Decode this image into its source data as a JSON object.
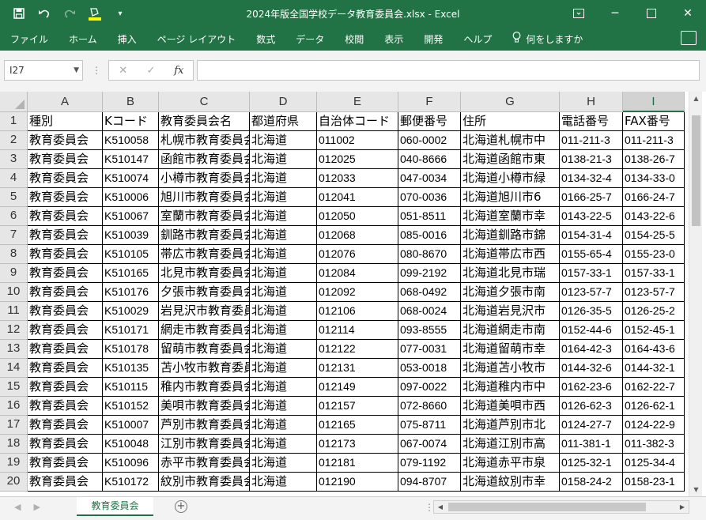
{
  "window": {
    "title": "2024年版全国学校データ教育委員会.xlsx  -  Excel",
    "controls": {
      "minimize": "─",
      "restore": "❐",
      "maximize": "☐",
      "close": "✕"
    }
  },
  "qat": {
    "save_icon": "save-icon",
    "undo_icon": "undo-icon",
    "redo_icon": "redo-icon",
    "fill_icon": "fill-color-icon",
    "customize_icon": "customize-icon"
  },
  "ribbon": {
    "tabs": [
      "ファイル",
      "ホーム",
      "挿入",
      "ページ レイアウト",
      "数式",
      "データ",
      "校閲",
      "表示",
      "開発",
      "ヘルプ"
    ],
    "tell_me": "何をしますか"
  },
  "formula_bar": {
    "name_box": "I27",
    "cancel": "✕",
    "enter": "✓",
    "fx": "fx",
    "value": ""
  },
  "columns": [
    "A",
    "B",
    "C",
    "D",
    "E",
    "F",
    "G",
    "H",
    "I"
  ],
  "rows": [
    {
      "n": "1",
      "cells": [
        "種別",
        "Kコード",
        "教育委員会名",
        "都道府県",
        "自治体コード",
        "郵便番号",
        "住所",
        "電話番号",
        "FAX番号"
      ]
    },
    {
      "n": "2",
      "cells": [
        "教育委員会",
        "K510058",
        "札幌市教育委員会",
        "北海道",
        "011002",
        "060-0002",
        "北海道札幌市中",
        "011-211-3",
        "011-211-3"
      ]
    },
    {
      "n": "3",
      "cells": [
        "教育委員会",
        "K510147",
        "函館市教育委員会",
        "北海道",
        "012025",
        "040-8666",
        "北海道函館市東",
        "0138-21-3",
        "0138-26-7"
      ]
    },
    {
      "n": "4",
      "cells": [
        "教育委員会",
        "K510074",
        "小樽市教育委員会",
        "北海道",
        "012033",
        "047-0034",
        "北海道小樽市緑",
        "0134-32-4",
        "0134-33-0"
      ]
    },
    {
      "n": "5",
      "cells": [
        "教育委員会",
        "K510006",
        "旭川市教育委員会",
        "北海道",
        "012041",
        "070-0036",
        "北海道旭川市6",
        "0166-25-7",
        "0166-24-7"
      ]
    },
    {
      "n": "6",
      "cells": [
        "教育委員会",
        "K510067",
        "室蘭市教育委員会",
        "北海道",
        "012050",
        "051-8511",
        "北海道室蘭市幸",
        "0143-22-5",
        "0143-22-6"
      ]
    },
    {
      "n": "7",
      "cells": [
        "教育委員会",
        "K510039",
        "釧路市教育委員会",
        "北海道",
        "012068",
        "085-0016",
        "北海道釧路市錦",
        "0154-31-4",
        "0154-25-5"
      ]
    },
    {
      "n": "8",
      "cells": [
        "教育委員会",
        "K510105",
        "帯広市教育委員会",
        "北海道",
        "012076",
        "080-8670",
        "北海道帯広市西",
        "0155-65-4",
        "0155-23-0"
      ]
    },
    {
      "n": "9",
      "cells": [
        "教育委員会",
        "K510165",
        "北見市教育委員会",
        "北海道",
        "012084",
        "099-2192",
        "北海道北見市瑞",
        "0157-33-1",
        "0157-33-1"
      ]
    },
    {
      "n": "10",
      "cells": [
        "教育委員会",
        "K510176",
        "夕張市教育委員会",
        "北海道",
        "012092",
        "068-0492",
        "北海道夕張市南",
        "0123-57-7",
        "0123-57-7"
      ]
    },
    {
      "n": "11",
      "cells": [
        "教育委員会",
        "K510029",
        "岩見沢市教育委員会",
        "北海道",
        "012106",
        "068-0024",
        "北海道岩見沢市",
        "0126-35-5",
        "0126-25-2"
      ]
    },
    {
      "n": "12",
      "cells": [
        "教育委員会",
        "K510171",
        "網走市教育委員会",
        "北海道",
        "012114",
        "093-8555",
        "北海道網走市南",
        "0152-44-6",
        "0152-45-1"
      ]
    },
    {
      "n": "13",
      "cells": [
        "教育委員会",
        "K510178",
        "留萌市教育委員会",
        "北海道",
        "012122",
        "077-0031",
        "北海道留萌市幸",
        "0164-42-3",
        "0164-43-6"
      ]
    },
    {
      "n": "14",
      "cells": [
        "教育委員会",
        "K510135",
        "苫小牧市教育委員会",
        "北海道",
        "012131",
        "053-0018",
        "北海道苫小牧市",
        "0144-32-6",
        "0144-32-1"
      ]
    },
    {
      "n": "15",
      "cells": [
        "教育委員会",
        "K510115",
        "稚内市教育委員会",
        "北海道",
        "012149",
        "097-0022",
        "北海道稚内市中",
        "0162-23-6",
        "0162-22-7"
      ]
    },
    {
      "n": "16",
      "cells": [
        "教育委員会",
        "K510152",
        "美唄市教育委員会",
        "北海道",
        "012157",
        "072-8660",
        "北海道美唄市西",
        "0126-62-3",
        "0126-62-1"
      ]
    },
    {
      "n": "17",
      "cells": [
        "教育委員会",
        "K510007",
        "芦別市教育委員会",
        "北海道",
        "012165",
        "075-8711",
        "北海道芦別市北",
        "0124-27-7",
        "0124-22-9"
      ]
    },
    {
      "n": "18",
      "cells": [
        "教育委員会",
        "K510048",
        "江別市教育委員会",
        "北海道",
        "012173",
        "067-0074",
        "北海道江別市高",
        "011-381-1",
        "011-382-3"
      ]
    },
    {
      "n": "19",
      "cells": [
        "教育委員会",
        "K510096",
        "赤平市教育委員会",
        "北海道",
        "012181",
        "079-1192",
        "北海道赤平市泉",
        "0125-32-1",
        "0125-34-4"
      ]
    },
    {
      "n": "20",
      "cells": [
        "教育委員会",
        "K510172",
        "紋別市教育委員会",
        "北海道",
        "012190",
        "094-8707",
        "北海道紋別市幸",
        "0158-24-2",
        "0158-23-1"
      ]
    }
  ],
  "sheets": {
    "active": "教育委員会",
    "add": "+"
  },
  "scroll": {
    "up": "▲",
    "down": "▼",
    "left": "◀",
    "right": "▶"
  },
  "colors": {
    "accent": "#217346"
  }
}
